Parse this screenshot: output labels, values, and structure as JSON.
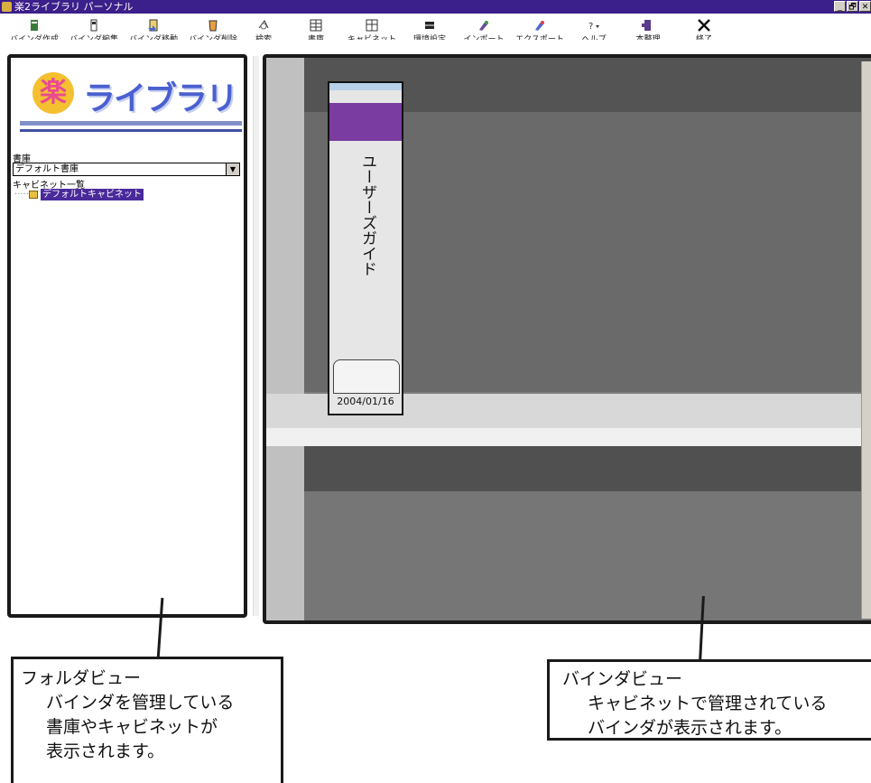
{
  "window": {
    "title": "楽2ライブラリ パーソナル",
    "buttons": [
      "_",
      "🗗",
      "✕"
    ]
  },
  "toolbar": {
    "items": [
      {
        "label": "バインダ作成",
        "icon": "binder-create-icon"
      },
      {
        "label": "バインダ編集",
        "icon": "binder-edit-icon"
      },
      {
        "label": "バインダ移動",
        "icon": "binder-move-icon"
      },
      {
        "label": "バインダ削除",
        "icon": "binder-delete-icon"
      },
      {
        "label": "検索",
        "icon": "search-icon"
      },
      {
        "label": "書庫",
        "icon": "library-icon"
      },
      {
        "label": "キャビネット",
        "icon": "cabinet-icon"
      },
      {
        "label": "環境設定",
        "icon": "settings-icon"
      },
      {
        "label": "インポート",
        "icon": "import-icon"
      },
      {
        "label": "エクスポート",
        "icon": "export-icon"
      },
      {
        "label": "ヘルプ",
        "icon": "help-icon"
      },
      {
        "label": "本整理",
        "icon": "organize-icon"
      },
      {
        "label": "終了",
        "icon": "close-icon"
      }
    ]
  },
  "folder_view": {
    "logo_text": "ライブラリ",
    "logo_kanji": "楽",
    "library_label": "書庫",
    "library_selected": "デフォルト書庫",
    "cabinet_list_label": "キャビネット一覧",
    "cabinet_items": [
      "デフォルトキャビネット"
    ]
  },
  "binder_view": {
    "binder_title": "ユーザーズガイド",
    "binder_date": "2004/01/16"
  },
  "callouts": {
    "folder": {
      "title": "フォルダビュー",
      "lines": [
        "バインダを管理している",
        "書庫やキャビネットが",
        "表示されます。"
      ]
    },
    "binder": {
      "title": "バインダビュー",
      "lines": [
        "キャビネットで管理されている",
        "バインダが表示されます。"
      ]
    }
  }
}
